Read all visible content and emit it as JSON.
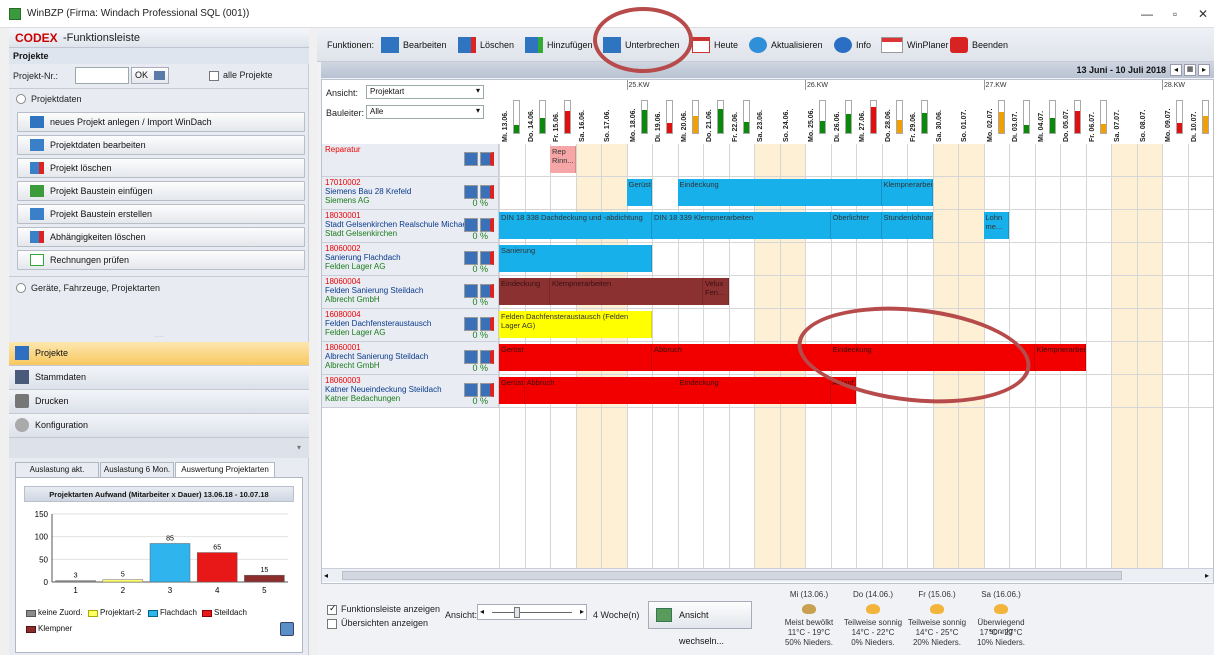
{
  "window": {
    "title": "WinBZP (Firma: Windach Professional SQL  (001))",
    "min": "—",
    "max": "▫",
    "close": "✕"
  },
  "left": {
    "logo": "CODEX",
    "logo_suffix": "-Funktionsleiste",
    "section_title": "Projekte",
    "projnr_label": "Projekt-Nr.:",
    "projnr_value": "",
    "ok_label": "OK",
    "all_label": "alle Projekte",
    "projektdaten_label": "Projektdaten",
    "buttons": [
      "neues Projekt anlegen / Import WinDach",
      "Projektdaten bearbeiten",
      "Projekt löschen",
      "Projekt Baustein einfügen",
      "Projekt Baustein erstellen",
      "Abhängigkeiten löschen",
      "Rechnungen prüfen"
    ],
    "geraete_label": "Geräte, Fahrzeuge, Projektarten",
    "splitter": "·····",
    "nav": [
      "Projekte",
      "Stammdaten",
      "Drucken",
      "Konfiguration"
    ],
    "tabs": [
      "Auslastung akt. Ansicht",
      "Auslastung 6 Mon.",
      "Auswertung Projektarten"
    ],
    "legend": [
      "keine Zuord.",
      "Projektart-2",
      "Flachdach",
      "Steildach",
      "Klempner"
    ]
  },
  "chart_data": {
    "type": "bar",
    "title": "Projektarten Aufwand (Mitarbeiter x Dauer) 13.06.18 - 10.07.18",
    "categories": [
      "1",
      "2",
      "3",
      "4",
      "5"
    ],
    "values": [
      3,
      5,
      85,
      65,
      15
    ],
    "data_labels": [
      "3",
      "5",
      "85",
      "65",
      "15"
    ],
    "ylim": [
      0,
      150
    ],
    "yticks": [
      "150",
      "100",
      "50",
      "0"
    ],
    "colors": [
      "#8a8a8a",
      "#ffff66",
      "#2fb4ee",
      "#e81818",
      "#8b2d2d"
    ]
  },
  "toolbar": {
    "label": "Funktionen:",
    "items": [
      "Bearbeiten",
      "Löschen",
      "Hinzufügen",
      "Unterbrechen",
      "Heute",
      "Aktualisieren",
      "Info",
      "WinPlaner",
      "Beenden"
    ]
  },
  "daterange": "13 Juni - 10 Juli 2018",
  "filters": {
    "ansicht_label": "Ansicht:",
    "ansicht_value": "Projektart",
    "bauleiter_label": "Bauleiter:",
    "bauleiter_value": "Alle"
  },
  "weeks": [
    "25.KW",
    "26.KW",
    "27.KW",
    "28.KW"
  ],
  "days": [
    "Mi. 13.06.",
    "Do. 14.06.",
    "Fr. 15.06.",
    "Sa. 16.06.",
    "So. 17.06.",
    "Mo. 18.06.",
    "Di. 19.06.",
    "Mi. 20.06.",
    "Do. 21.06.",
    "Fr. 22.06.",
    "Sa. 23.06.",
    "So. 24.06.",
    "Mo. 25.06.",
    "Di. 26.06.",
    "Mi. 27.06.",
    "Do. 28.06.",
    "Fr. 29.06.",
    "Sa. 30.06.",
    "So. 01.07.",
    "Mo. 02.07.",
    "Di. 03.07.",
    "Mi. 04.07.",
    "Do. 05.07.",
    "Fr. 06.07.",
    "Sa. 07.07.",
    "So. 08.07.",
    "Mo. 09.07.",
    "Di. 10.07."
  ],
  "rows": [
    {
      "id": "Reparatur",
      "name": "",
      "customer": "",
      "pct": ""
    },
    {
      "id": "17010002",
      "name": "Siemens Bau 28 Krefeld",
      "customer": "Siemens AG",
      "pct": "0 %"
    },
    {
      "id": "18030001",
      "name": "Stadt Gelsenkirchen Realschule Michaels",
      "customer": "Stadt Gelsenkirchen",
      "pct": "0 %"
    },
    {
      "id": "18060002",
      "name": "Sanierung Flachdach",
      "customer": "Felden Lager AG",
      "pct": "0 %"
    },
    {
      "id": "18060004",
      "name": "Felden Sanierung Steildach",
      "customer": "Albrecht GmbH",
      "pct": "0 %"
    },
    {
      "id": "16080004",
      "name": "Felden Dachfensteraustausch",
      "customer": "Felden Lager AG",
      "pct": "0 %"
    },
    {
      "id": "18060001",
      "name": "Albrecht Sanierung Steildach",
      "customer": "Albrecht GmbH",
      "pct": "0 %"
    },
    {
      "id": "18060003",
      "name": "Katner Neueindeckung Steildach",
      "customer": "Katner Bedachungen",
      "pct": "0 %"
    }
  ],
  "bars": [
    {
      "row": 0,
      "start": 2,
      "len": 1,
      "color": "#f6a6a6",
      "label": "Rep Rinn..."
    },
    {
      "row": 1,
      "start": 5,
      "len": 1,
      "color": "#18b0ea",
      "label": "Gerüst"
    },
    {
      "row": 1,
      "start": 7,
      "len": 8,
      "color": "#18b0ea",
      "label": "Eindeckung"
    },
    {
      "row": 1,
      "start": 15,
      "len": 2,
      "color": "#18b0ea",
      "label": "Klempnerarbeiten"
    },
    {
      "row": 2,
      "start": 0,
      "len": 6,
      "color": "#18b0ea",
      "label": "DIN 18 338 Dachdeckung und -abdichtung"
    },
    {
      "row": 2,
      "start": 6,
      "len": 7,
      "color": "#18b0ea",
      "label": "DIN 18 339 Klempnerarbeiten"
    },
    {
      "row": 2,
      "start": 13,
      "len": 2,
      "color": "#18b0ea",
      "label": "Oberlichter"
    },
    {
      "row": 2,
      "start": 15,
      "len": 2,
      "color": "#18b0ea",
      "label": "Stundenlohnarbeiten"
    },
    {
      "row": 2,
      "start": 19,
      "len": 1,
      "color": "#18b0ea",
      "label": "Lohn me..."
    },
    {
      "row": 3,
      "start": 0,
      "len": 6,
      "color": "#18b0ea",
      "label": "Sanierung"
    },
    {
      "row": 4,
      "start": 0,
      "len": 2,
      "color": "#8b3131",
      "label": "Eindeckung"
    },
    {
      "row": 4,
      "start": 2,
      "len": 6,
      "color": "#8b3131",
      "label": "Klempnerarbeiten"
    },
    {
      "row": 4,
      "start": 8,
      "len": 1,
      "color": "#8b3131",
      "label": "Velux Fen..."
    },
    {
      "row": 5,
      "start": 0,
      "len": 6,
      "color": "#ffff00",
      "label": "Felden Dachfensteraustausch (Felden Lager AG)"
    },
    {
      "row": 6,
      "start": 0,
      "len": 6,
      "color": "#f20000",
      "label": "Gerüst"
    },
    {
      "row": 6,
      "start": 6,
      "len": 8,
      "color": "#f20000",
      "label": "Abbruch"
    },
    {
      "row": 6,
      "start": 13,
      "len": 8,
      "color": "#f20000",
      "label": "Eindeckung"
    },
    {
      "row": 6,
      "start": 21,
      "len": 2,
      "color": "#f20000",
      "label": "Klempnerarbeiten"
    },
    {
      "row": 7,
      "start": 0,
      "len": 1,
      "color": "#f20000",
      "label": "Gerüst"
    },
    {
      "row": 7,
      "start": 1,
      "len": 7,
      "color": "#f20000",
      "label": "Abbruch"
    },
    {
      "row": 7,
      "start": 7,
      "len": 6,
      "color": "#f20000",
      "label": "Eindeckung"
    },
    {
      "row": 7,
      "start": 13,
      "len": 1,
      "color": "#f20000",
      "label": "Ablauf..."
    }
  ],
  "bottom": {
    "chk1": "Funktionsleiste anzeigen",
    "chk2": "Übersichten anzeigen",
    "ansicht_label": "Ansicht:",
    "weeks_label": "4 Woche(n)",
    "wechseln": "Ansicht wechseln...",
    "weather": [
      {
        "day": "Mi (13.06.)",
        "desc": "Meist bewölkt",
        "temp": "11°C - 19°C",
        "rain": "50% Nieders."
      },
      {
        "day": "Do (14.06.)",
        "desc": "Teilweise sonnig",
        "temp": "14°C - 22°C",
        "rain": "0% Nieders."
      },
      {
        "day": "Fr (15.06.)",
        "desc": "Teilweise sonnig",
        "temp": "14°C - 25°C",
        "rain": "20% Nieders."
      },
      {
        "day": "Sa (16.06.)",
        "desc": "Überwiegend sonnig",
        "temp": "17°C - 27°C",
        "rain": "10% Nieders."
      }
    ]
  }
}
